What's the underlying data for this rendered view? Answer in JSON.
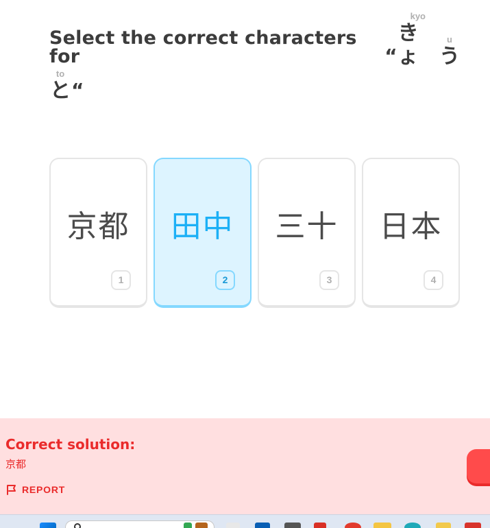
{
  "prompt": {
    "text_before": "Select the correct characters for ",
    "open_quote": "“",
    "close_quote": "“",
    "ruby": [
      {
        "reading": "kyo",
        "kana": "きょ",
        "small_tail": true
      },
      {
        "reading": "u",
        "kana": "う"
      },
      {
        "reading": "to",
        "kana": "と"
      }
    ]
  },
  "choices": [
    {
      "characters": "京都",
      "key": "1",
      "selected": false
    },
    {
      "characters": "田中",
      "key": "2",
      "selected": true
    },
    {
      "characters": "三十",
      "key": "3",
      "selected": false
    },
    {
      "characters": "日本",
      "key": "4",
      "selected": false
    }
  ],
  "feedback": {
    "title": "Correct solution:",
    "answer": "京都",
    "report_label": "REPORT",
    "background_color": "#ffdfe0",
    "accent_color": "#ea2b2b"
  },
  "colors": {
    "selected_bg": "#ddf4ff",
    "selected_border": "#84d8ff",
    "selected_text": "#1cb0f6",
    "continue_button": "#ff4b4b"
  },
  "taskbar": {
    "icons": [
      "windows-start-icon",
      "search-box",
      "drive-icon",
      "file-icon",
      "copilot-icon",
      "terminal-icon",
      "pdf-icon",
      "chrome-icon",
      "file-explorer-icon",
      "edge-icon",
      "folder-icon",
      "app-icon"
    ]
  }
}
